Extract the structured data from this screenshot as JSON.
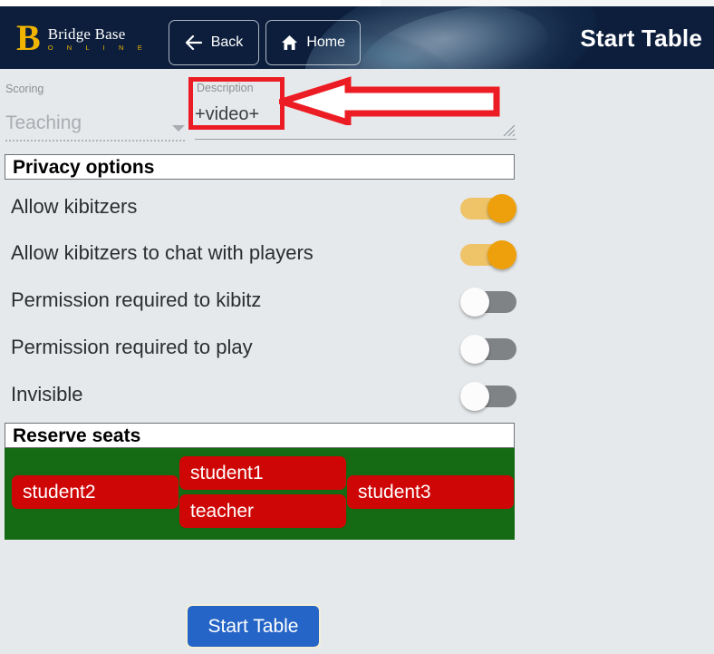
{
  "header": {
    "logo": {
      "monogram": "B",
      "title": "Bridge Base",
      "subtitle": "O N L I N E"
    },
    "back_label": "Back",
    "home_label": "Home",
    "title": "Start Table"
  },
  "form": {
    "scoring": {
      "label": "Scoring",
      "value": "Teaching"
    },
    "description": {
      "label": "Description",
      "value": "+video+"
    }
  },
  "privacy": {
    "section_title": "Privacy options",
    "options": [
      {
        "label": "Allow kibitzers",
        "state": "on"
      },
      {
        "label": "Allow kibitzers to chat with players",
        "state": "on"
      },
      {
        "label": "Permission required to kibitz",
        "state": "off"
      },
      {
        "label": "Permission required to play",
        "state": "off"
      },
      {
        "label": "Invisible",
        "state": "off"
      }
    ]
  },
  "reserve": {
    "section_title": "Reserve seats",
    "seats": {
      "north": "student1",
      "south": "teacher",
      "west": "student2",
      "east": "student3"
    }
  },
  "footer": {
    "start_label": "Start Table"
  },
  "colors": {
    "header_bg": "#0c1e3c",
    "page_bg": "#e6e9eb",
    "logo_gold": "#f0b400",
    "toggle_on_track": "#efc469",
    "toggle_on_knob": "#eda00c",
    "toggle_off_track": "#808386",
    "table_green": "#146b14",
    "seat_red": "#cf0606",
    "start_blue": "#2565c7",
    "annotation_red": "#ec1c24"
  }
}
